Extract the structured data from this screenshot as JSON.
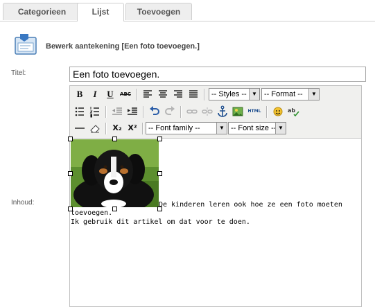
{
  "tabs": [
    "Categorieen",
    "Lijst",
    "Toevoegen"
  ],
  "header": {
    "title": "Bewerk aantekening [Een foto toevoegen.]"
  },
  "form": {
    "title_label": "Titel:",
    "title_value": "Een foto toevoegen.",
    "content_label": "Inhoud:"
  },
  "toolbar": {
    "bold": "B",
    "italic": "I",
    "underline": "U",
    "strike": "ABC",
    "html": "HTML",
    "subscript": "X₂",
    "superscript": "X²",
    "styles": "-- Styles --",
    "format": "-- Format --",
    "font_family": "-- Font family --",
    "font_size": "-- Font size --"
  },
  "content": {
    "line1a": "De kinderen leren ook hoe ze een foto moeten",
    "line1b": "toevoegen.",
    "line2": "Ik gebruik dit artikel om dat voor te doen."
  }
}
